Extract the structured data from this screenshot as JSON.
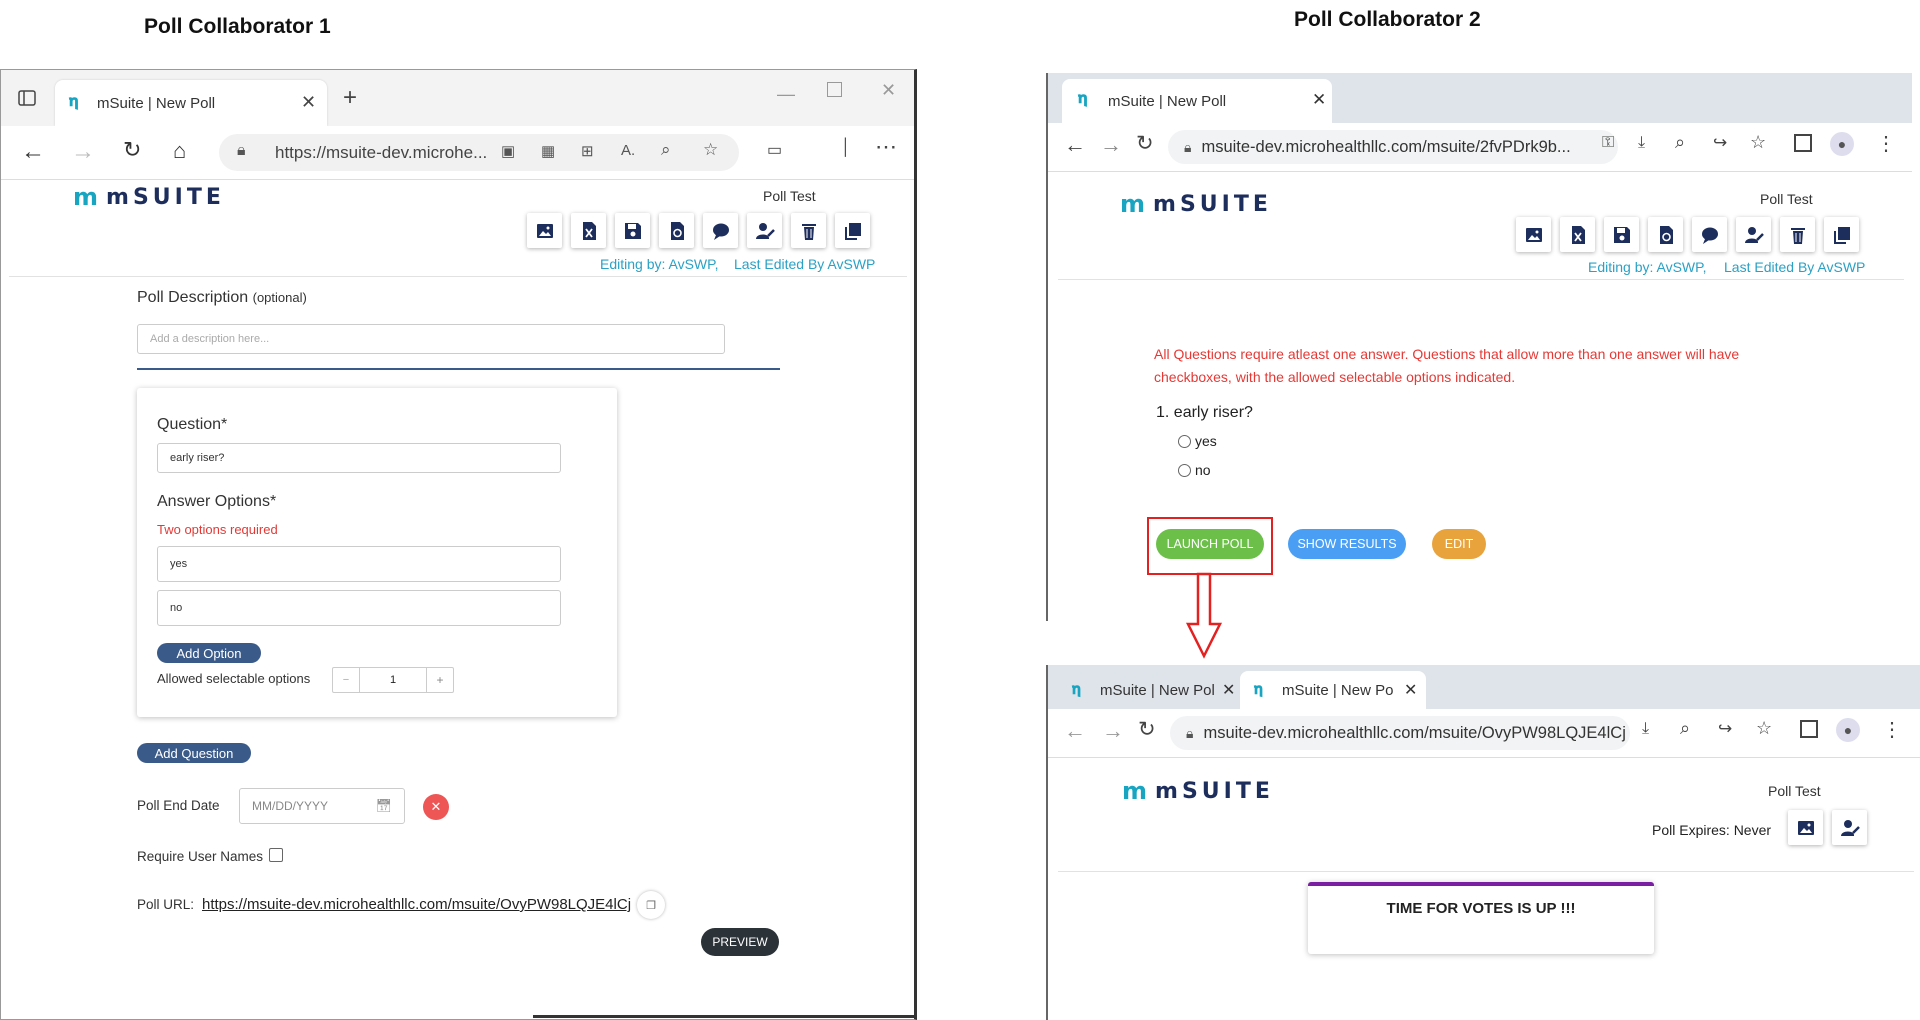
{
  "captions": {
    "left": "Poll Collaborator 1",
    "right": "Poll Collaborator 2"
  },
  "colors": {
    "accent_blue": "#2aa1c5",
    "brand_navy": "#1d2d5c",
    "error_red": "#e53935",
    "launch_green": "#6cc04a",
    "results_blue": "#4a9ff5",
    "edit_orange": "#e8a33d",
    "timer_purple": "#7b1fa2"
  },
  "win1": {
    "tab_title": "mSuite | New Poll",
    "url": "https://msuite-dev.microhe...",
    "logo_m": "m",
    "logo_text": "mSUITE",
    "poll_name": "Poll Test",
    "editing_by": "Editing by: AvSWP,",
    "last_edited": "Last Edited By AvSWP",
    "toolbar_icons": [
      "image-icon",
      "excel-icon",
      "save-icon",
      "reset-icon",
      "chat-icon",
      "user-edit-icon",
      "trash-icon",
      "copy-icon"
    ],
    "desc_label": "Poll Description",
    "desc_optional": "(optional)",
    "desc_placeholder": "Add a description here...",
    "question_label": "Question*",
    "question_value": "early riser?",
    "answers_label": "Answer Options*",
    "answers_error": "Two options required",
    "options": [
      "yes",
      "no"
    ],
    "add_option": "Add Option",
    "allowed_label": "Allowed selectable options",
    "stepper_minus": "−",
    "stepper_value": "1",
    "stepper_plus": "+",
    "add_question": "Add Question",
    "end_date_label": "Poll End Date",
    "end_date_placeholder": "MM/DD/YYYY",
    "require_names_label": "Require User Names",
    "poll_url_label": "Poll URL:",
    "poll_url_value": "https://msuite-dev.microhealthllc.com/msuite/OvyPW98LQJE4lCj",
    "preview": "PREVIEW"
  },
  "win2": {
    "tab_title": "mSuite | New Poll",
    "url": "msuite-dev.microhealthllc.com/msuite/2fvPDrk9b...",
    "poll_name": "Poll Test",
    "editing_by": "Editing by: AvSWP,",
    "last_edited": "Last Edited By AvSWP",
    "notice_line1": "All Questions require atleast one answer. Questions that allow more than one answer will have",
    "notice_line2": "checkboxes, with the allowed selectable options indicated.",
    "question": "1. early riser?",
    "options": [
      "yes",
      "no"
    ],
    "launch": "LAUNCH POLL",
    "show_results": "SHOW RESULTS",
    "edit": "EDIT"
  },
  "win3": {
    "tab1_title": "mSuite | New Pol",
    "tab2_title": "mSuite | New Po",
    "url": "msuite-dev.microhealthllc.com/msuite/OvyPW98LQJE4lCj",
    "poll_name": "Poll Test",
    "expires": "Poll Expires: Never",
    "timer_message": "TIME FOR VOTES IS UP !!!"
  }
}
